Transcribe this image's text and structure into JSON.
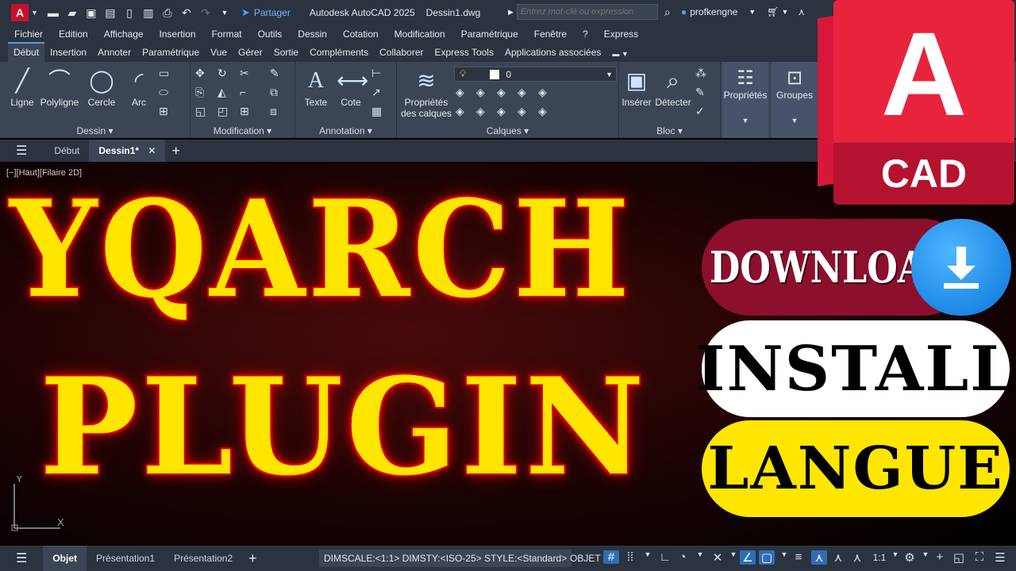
{
  "titlebar": {
    "app_letter": "A",
    "share_label": "Partager",
    "app_title": "Autodesk AutoCAD 2025",
    "file_name": "Dessin1.dwg",
    "search_placeholder": "Entrez mot-clé ou expression",
    "user_name": "profkengne"
  },
  "menubar": [
    "Fichier",
    "Edition",
    "Affichage",
    "Insertion",
    "Format",
    "Outils",
    "Dessin",
    "Cotation",
    "Modification",
    "Paramétrique",
    "Fenêtre",
    "?",
    "Express"
  ],
  "ribbon_tabs": [
    "Début",
    "Insertion",
    "Annoter",
    "Paramétrique",
    "Vue",
    "Gérer",
    "Sortie",
    "Compléments",
    "Collaborer",
    "Express Tools",
    "Applications associées"
  ],
  "ribbon": {
    "draw_tools": [
      "Ligne",
      "Polyligne",
      "Cercle",
      "Arc"
    ],
    "panel_dessin": "Dessin",
    "panel_modification": "Modification",
    "annotation_tools": [
      "Texte",
      "Cote"
    ],
    "panel_annotation": "Annotation",
    "layer_props_line1": "Propriétés",
    "layer_props_line2": "des calques",
    "layer_value": "0",
    "panel_calques": "Calques",
    "bloc_tools": [
      "Insérer",
      "Détecter"
    ],
    "panel_bloc": "Bloc",
    "properties_label": "Propriétés",
    "groups_label": "Groupes"
  },
  "doc_tabs": {
    "start": "Début",
    "active": "Dessin1*"
  },
  "viewport": {
    "view_label": "[−][Haut][Filaire 2D]",
    "word_1": "YQARCH",
    "word_2": "PLUGIN",
    "ucs_y": "Y",
    "ucs_x": "X"
  },
  "badges": {
    "logo_letter": "A",
    "logo_text": "CAD",
    "download": "DOWNLOAD",
    "install": "INSTALL",
    "langue": "LANGUE"
  },
  "statusbar": {
    "tabs": [
      "Objet",
      "Présentation1",
      "Présentation2"
    ],
    "dim_info": "DIMSCALE:<1:1> DIMSTY:<ISO-25> STYLE:<Standard>",
    "mode": "OBJET",
    "scale": "1:1"
  },
  "colors": {
    "accent_blue": "#4aa3ff",
    "brand_red": "#e8243d",
    "title_yellow": "#ffe600"
  }
}
